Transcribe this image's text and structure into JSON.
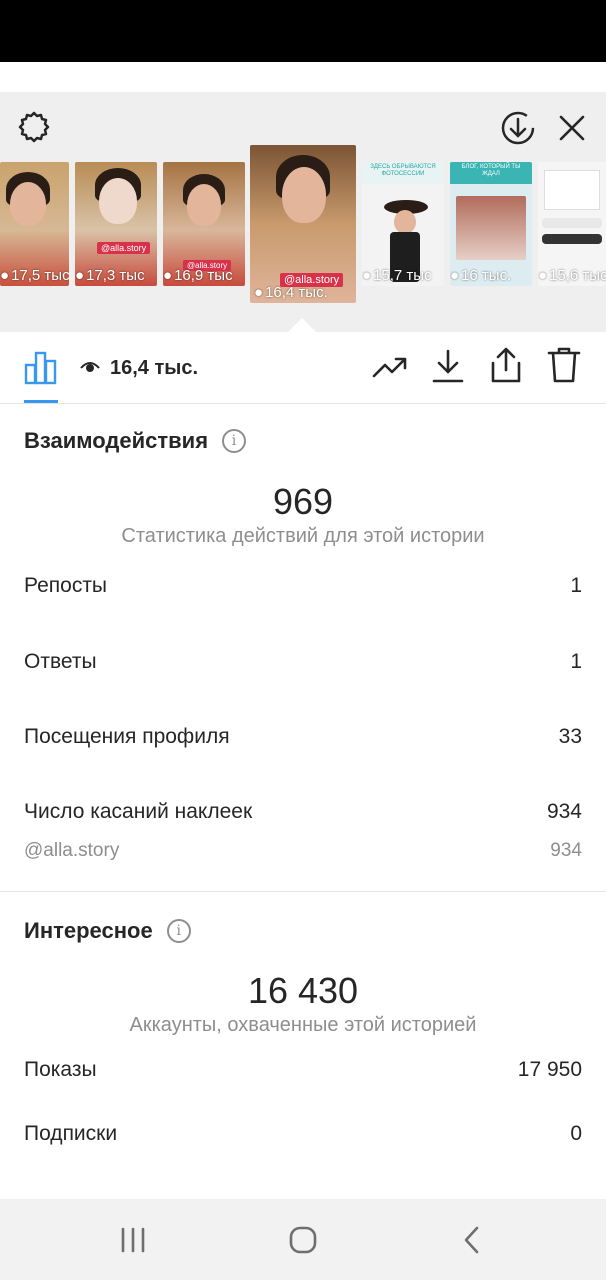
{
  "stories": [
    {
      "views": "17,5 тыс",
      "caption": ""
    },
    {
      "views": "17,3 тыс",
      "caption": ""
    },
    {
      "views": "16,9 тыс",
      "tag": "@alla.story"
    },
    {
      "views": "16,4 тыс.",
      "tag": "@alla.story"
    },
    {
      "views": "15,7 тыс",
      "header": "ЗДЕСЬ ОБРЫВАЮТСЯ ФОТОСЕССИИ"
    },
    {
      "views": "16 тыс.",
      "header": "БЛОГ, КОТОРЫЙ ТЫ ЖДАЛ"
    },
    {
      "views": "15,6 тыс",
      "header": ""
    }
  ],
  "story_tags": {
    "first": "@alla.story",
    "selected": "@alla.story"
  },
  "toolbar": {
    "views_count": "16,4 тыс."
  },
  "interactions": {
    "title": "Взаимодействия",
    "total": "969",
    "subtitle": "Статистика действий для этой истории",
    "rows": [
      {
        "label": "Репосты",
        "value": "1"
      },
      {
        "label": "Ответы",
        "value": "1"
      },
      {
        "label": "Посещения профиля",
        "value": "33"
      },
      {
        "label": "Число касаний наклеек",
        "value": "934"
      }
    ],
    "sticker": {
      "label": "@alla.story",
      "value": "934"
    }
  },
  "discovery": {
    "title": "Интересное",
    "total": "16 430",
    "subtitle": "Аккаунты, охваченные этой историей",
    "rows": [
      {
        "label": "Показы",
        "value": "17 950"
      },
      {
        "label": "Подписки",
        "value": "0"
      }
    ]
  },
  "icons": {
    "info_glyph": "i"
  },
  "colors": {
    "accent": "#3897f0",
    "tag": "#d8324a"
  }
}
